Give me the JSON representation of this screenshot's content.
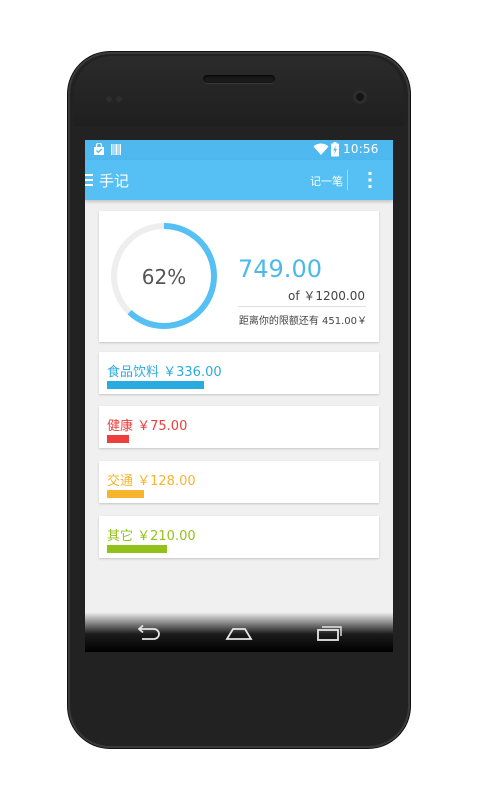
{
  "status": {
    "time": "10:56"
  },
  "header": {
    "title": "手记",
    "add_label": "记一笔"
  },
  "summary": {
    "percent_label": "62%",
    "percent_value": 0.62,
    "spent": "749.00",
    "limit_label": "of ￥1200.00",
    "remaining_label": "距离你的限额还有 451.00￥"
  },
  "colors": {
    "accent": "#56c0f4",
    "ring_track": "#eeeeee"
  },
  "categories": [
    {
      "label": "食品饮料 ￥336.00",
      "color": "#2aabdf",
      "fraction": 0.449
    },
    {
      "label": "健康 ￥75.00",
      "color": "#ee3d3d",
      "fraction": 0.1
    },
    {
      "label": "交通 ￥128.00",
      "color": "#f7b52d",
      "fraction": 0.171
    },
    {
      "label": "其它 ￥210.00",
      "color": "#92c21a",
      "fraction": 0.28
    }
  ]
}
